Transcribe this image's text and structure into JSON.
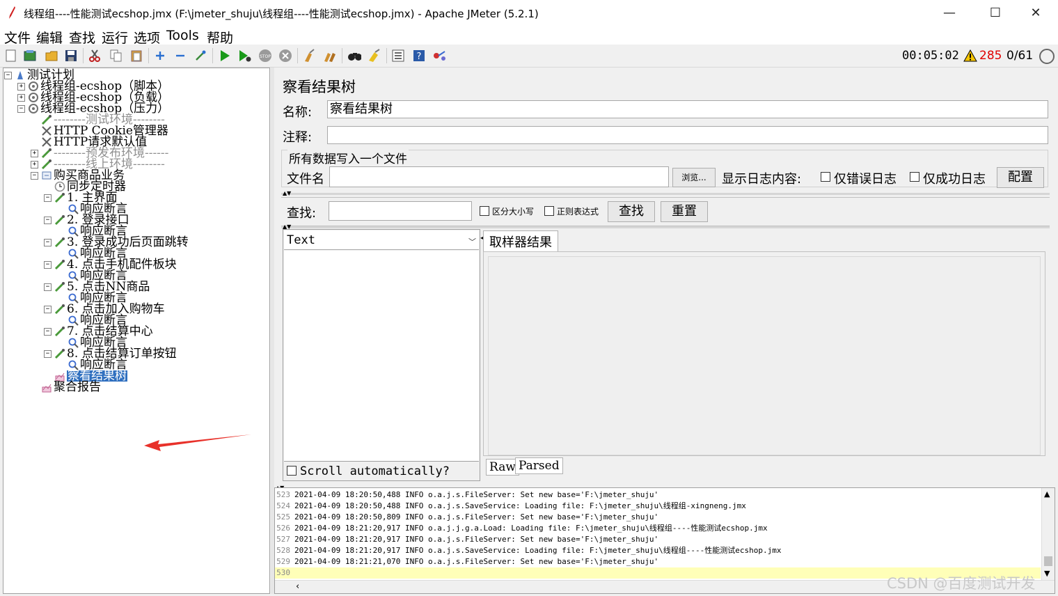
{
  "window": {
    "title": "线程组----性能测试ecshop.jmx (F:\\jmeter_shuju\\线程组----性能测试ecshop.jmx) - Apache JMeter (5.2.1)",
    "minimize": "—",
    "maximize": "☐",
    "close": "✕"
  },
  "menu": {
    "items": [
      "文件",
      "编辑",
      "查找",
      "运行",
      "选项",
      "Tools",
      "帮助"
    ]
  },
  "toolbar": {
    "timer": "00:05:02",
    "warnings": "285",
    "threads": "0/61",
    "buttons": [
      "new-icon",
      "templates-icon",
      "open-icon",
      "save-icon",
      "cut-icon",
      "copy-icon",
      "paste-icon",
      "expand-icon",
      "collapse-icon",
      "toggle-icon",
      "start-icon",
      "start-no-pause-icon",
      "stop-icon",
      "shutdown-icon",
      "clear-icon",
      "clear-all-icon",
      "search-icon",
      "reset-search-icon",
      "function-helper-icon",
      "help-icon",
      "remote-icon"
    ]
  },
  "tree": {
    "items": [
      {
        "label": "测试计划",
        "depth": 0,
        "icon": "test-plan-icon",
        "expander": "−"
      },
      {
        "label": "线程组-ecshop（脚本）",
        "depth": 1,
        "icon": "thread-group-icon",
        "expander": "+"
      },
      {
        "label": "线程组-ecshop（负载）",
        "depth": 1,
        "icon": "thread-group-icon",
        "expander": "+"
      },
      {
        "label": "线程组-ecshop（压力）",
        "depth": 1,
        "icon": "thread-group-icon",
        "expander": "−"
      },
      {
        "label": "--------测试环境--------",
        "depth": 2,
        "icon": "sampler-icon",
        "expander": "",
        "disabled": true
      },
      {
        "label": "HTTP Cookie管理器",
        "depth": 2,
        "icon": "config-icon",
        "expander": ""
      },
      {
        "label": "HTTP请求默认值",
        "depth": 2,
        "icon": "config-icon",
        "expander": ""
      },
      {
        "label": "--------预发布环境------",
        "depth": 2,
        "icon": "sampler-icon",
        "expander": "+",
        "disabled": true
      },
      {
        "label": "--------线上环境--------",
        "depth": 2,
        "icon": "sampler-icon",
        "expander": "+",
        "disabled": true
      },
      {
        "label": "购买商品业务",
        "depth": 2,
        "icon": "controller-icon",
        "expander": "−"
      },
      {
        "label": "同步定时器",
        "depth": 3,
        "icon": "timer-icon",
        "expander": ""
      },
      {
        "label": "1. 主界面",
        "depth": 3,
        "icon": "sampler-icon",
        "expander": "−"
      },
      {
        "label": "响应断言",
        "depth": 4,
        "icon": "assertion-icon",
        "expander": ""
      },
      {
        "label": "2. 登录接口",
        "depth": 3,
        "icon": "sampler-icon",
        "expander": "−"
      },
      {
        "label": "响应断言",
        "depth": 4,
        "icon": "assertion-icon",
        "expander": ""
      },
      {
        "label": "3. 登录成功后页面跳转",
        "depth": 3,
        "icon": "sampler-icon",
        "expander": "−"
      },
      {
        "label": "响应断言",
        "depth": 4,
        "icon": "assertion-icon",
        "expander": ""
      },
      {
        "label": "4. 点击手机配件板块",
        "depth": 3,
        "icon": "sampler-icon",
        "expander": "−"
      },
      {
        "label": "响应断言",
        "depth": 4,
        "icon": "assertion-icon",
        "expander": ""
      },
      {
        "label": "5. 点击NN商品",
        "depth": 3,
        "icon": "sampler-icon",
        "expander": "−"
      },
      {
        "label": "响应断言",
        "depth": 4,
        "icon": "assertion-icon",
        "expander": ""
      },
      {
        "label": "6. 点击加入购物车",
        "depth": 3,
        "icon": "sampler-icon",
        "expander": "−"
      },
      {
        "label": "响应断言",
        "depth": 4,
        "icon": "assertion-icon",
        "expander": ""
      },
      {
        "label": "7. 点击结算中心",
        "depth": 3,
        "icon": "sampler-icon",
        "expander": "−"
      },
      {
        "label": "响应断言",
        "depth": 4,
        "icon": "assertion-icon",
        "expander": ""
      },
      {
        "label": "8. 点击结算订单按钮",
        "depth": 3,
        "icon": "sampler-icon",
        "expander": "−"
      },
      {
        "label": "响应断言",
        "depth": 4,
        "icon": "assertion-icon",
        "expander": ""
      },
      {
        "label": "察看结果树",
        "depth": 3,
        "icon": "listener-icon",
        "expander": "",
        "selected": true
      },
      {
        "label": "聚合报告",
        "depth": 2,
        "icon": "listener-icon",
        "expander": ""
      }
    ]
  },
  "panel": {
    "title": "察看结果树",
    "name_label": "名称:",
    "name_value": "察看结果树",
    "comment_label": "注释:",
    "comment_value": "",
    "file_group_title": "所有数据写入一个文件",
    "filename_label": "文件名",
    "filename_value": "",
    "browse_label": "浏览...",
    "log_display_label": "显示日志内容:",
    "errors_only_label": "仅错误日志",
    "success_only_label": "仅成功日志",
    "configure_label": "配置",
    "search_label": "查找:",
    "search_value": "",
    "case_sensitive_label": "区分大小写",
    "regex_label": "正则表达式",
    "find_label": "查找",
    "reset_label": "重置",
    "renderer_value": "Text",
    "scroll_auto_label": "Scroll automatically?",
    "sampler_result_tab": "取样器结果",
    "raw_tab": "Raw",
    "parsed_tab": "Parsed"
  },
  "log": {
    "lines": [
      {
        "n": "523",
        "text": "2021-04-09 18:20:50,488 INFO o.a.j.s.FileServer: Set new base='F:\\jmeter_shuju'"
      },
      {
        "n": "524",
        "text": "2021-04-09 18:20:50,488 INFO o.a.j.s.SaveService: Loading file: F:\\jmeter_shuju\\线程组-xingneng.jmx"
      },
      {
        "n": "525",
        "text": "2021-04-09 18:20:50,809 INFO o.a.j.s.FileServer: Set new base='F:\\jmeter_shuju'"
      },
      {
        "n": "526",
        "text": "2021-04-09 18:21:20,917 INFO o.a.j.j.g.a.Load: Loading file: F:\\jmeter_shuju\\线程组----性能测试ecshop.jmx"
      },
      {
        "n": "527",
        "text": "2021-04-09 18:21:20,917 INFO o.a.j.s.FileServer: Set new base='F:\\jmeter_shuju'"
      },
      {
        "n": "528",
        "text": "2021-04-09 18:21:20,917 INFO o.a.j.s.SaveService: Loading file: F:\\jmeter_shuju\\线程组----性能测试ecshop.jmx"
      },
      {
        "n": "529",
        "text": "2021-04-09 18:21:21,070 INFO o.a.j.s.FileServer: Set new base='F:\\jmeter_shuju'"
      },
      {
        "n": "530",
        "text": ""
      }
    ]
  },
  "watermark": "CSDN @百度测试开发",
  "colors": {
    "selected_bg": "#2f6fbf",
    "warning_text": "#e00000",
    "log_current_line": "#ffffb8",
    "disabled_text": "#8f8f8f",
    "arrow": "#e8312a"
  }
}
